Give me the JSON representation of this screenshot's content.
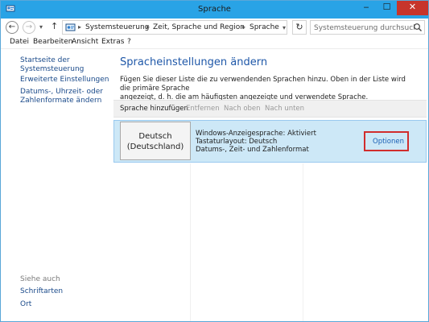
{
  "window": {
    "title": "Sprache",
    "minimize": "‒",
    "maximize": "☐",
    "close": "✕"
  },
  "address_bar": {
    "back": "←",
    "forward": "→",
    "dropdown": "▾",
    "up": "↑",
    "breadcrumb": [
      "Systemsteuerung",
      "Zeit, Sprache und Region",
      "Sprache"
    ],
    "separator": "▸",
    "refresh": "↻",
    "search_placeholder": "Systemsteuerung durchsuchen"
  },
  "menu": [
    "Datei",
    "Bearbeiten",
    "Ansicht",
    "Extras",
    "?"
  ],
  "sidebar": {
    "links": [
      "Startseite der Systemsteuerung",
      "Erweiterte Einstellungen",
      "Datums-, Uhrzeit- oder",
      "Zahlenformate ändern"
    ],
    "see_also_label": "Siehe auch",
    "see_also": [
      "Schriftarten",
      "Ort"
    ]
  },
  "main": {
    "title": "Spracheinstellungen ändern",
    "description_line1": "Fügen Sie dieser Liste die zu verwendenden Sprachen hinzu. Oben in der Liste wird die primäre Sprache",
    "description_line2": "angezeigt, d. h. die am häufigsten angezeigte und verwendete Sprache.",
    "toolbar": {
      "add": "Sprache hinzufügen",
      "remove": "Entfernen",
      "move_up": "Nach oben",
      "move_down": "Nach unten"
    },
    "languages": [
      {
        "name_line1": "Deutsch",
        "name_line2": "(Deutschland)",
        "info": [
          "Windows-Anzeigesprache: Aktiviert",
          "Tastaturlayout: Deutsch",
          "Datums-, Zeit- und Zahlenformat"
        ],
        "options": "Optionen"
      }
    ]
  },
  "colors": {
    "titlebar": "#29a3e6",
    "close_button": "#c7352b",
    "selected_row": "#cde8f7",
    "highlight_box": "#d12d2d",
    "link": "#1a5fb4",
    "page_title": "#1e57a8"
  }
}
